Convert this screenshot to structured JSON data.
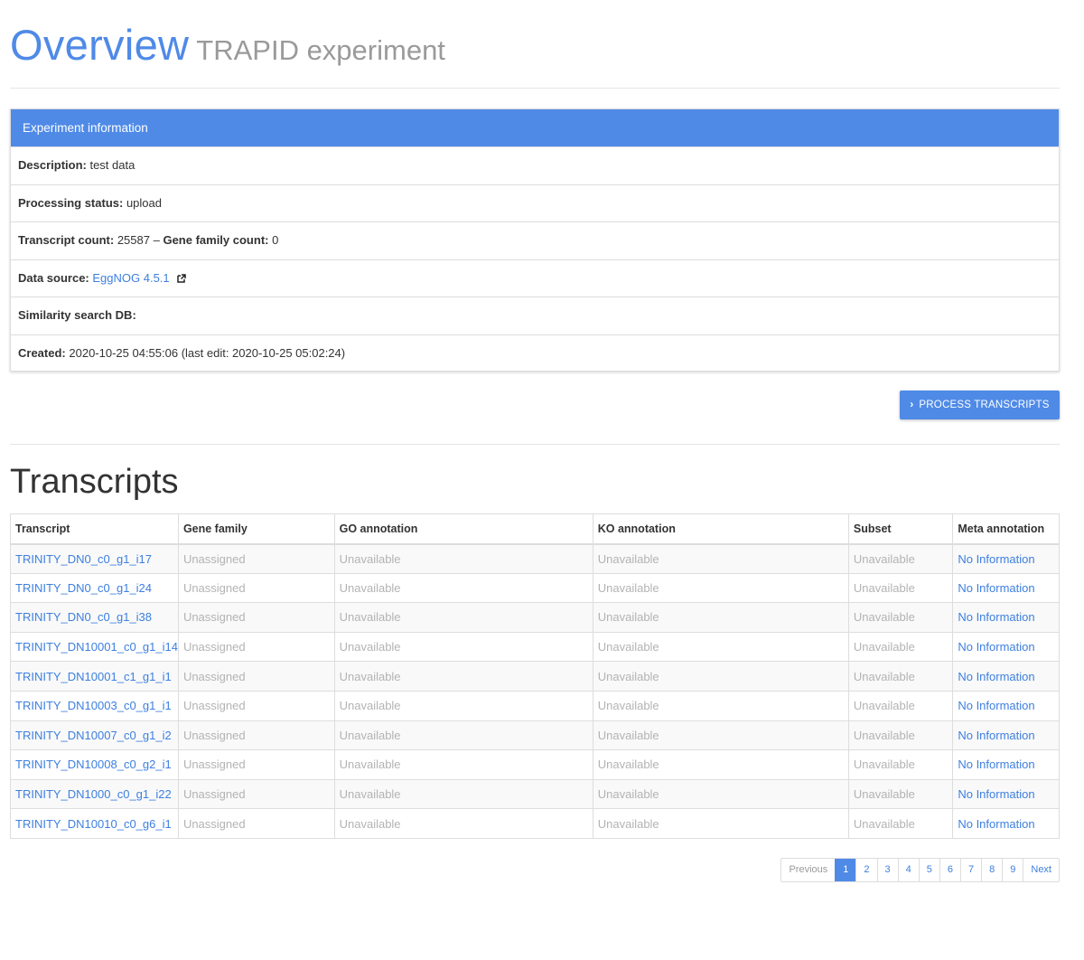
{
  "header": {
    "title": "Overview",
    "subtitle": "TRAPID experiment"
  },
  "experiment_panel": {
    "heading": "Experiment information",
    "description_label": "Description:",
    "description_value": "test data",
    "status_label": "Processing status:",
    "status_value": "upload",
    "transcript_count_label": "Transcript count:",
    "transcript_count_value": "25587",
    "separator": "–",
    "gene_family_count_label": "Gene family count:",
    "gene_family_count_value": "0",
    "data_source_label": "Data source:",
    "data_source_value": "EggNOG 4.5.1",
    "similarity_label": "Similarity search DB:",
    "similarity_value": "",
    "created_label": "Created:",
    "created_value": "2020-10-25 04:55:06 (last edit: 2020-10-25 05:02:24)"
  },
  "actions": {
    "process_label": "PROCESS TRANSCRIPTS",
    "process_icon": "chevron-right-icon"
  },
  "transcripts": {
    "title": "Transcripts",
    "columns": [
      "Transcript",
      "Gene family",
      "GO annotation",
      "KO annotation",
      "Subset",
      "Meta annotation"
    ],
    "rows": [
      {
        "transcript": "TRINITY_DN0_c0_g1_i17",
        "gene_family": "Unassigned",
        "go": "Unavailable",
        "ko": "Unavailable",
        "subset": "Unavailable",
        "meta": "No Information"
      },
      {
        "transcript": "TRINITY_DN0_c0_g1_i24",
        "gene_family": "Unassigned",
        "go": "Unavailable",
        "ko": "Unavailable",
        "subset": "Unavailable",
        "meta": "No Information"
      },
      {
        "transcript": "TRINITY_DN0_c0_g1_i38",
        "gene_family": "Unassigned",
        "go": "Unavailable",
        "ko": "Unavailable",
        "subset": "Unavailable",
        "meta": "No Information"
      },
      {
        "transcript": "TRINITY_DN10001_c0_g1_i14",
        "gene_family": "Unassigned",
        "go": "Unavailable",
        "ko": "Unavailable",
        "subset": "Unavailable",
        "meta": "No Information"
      },
      {
        "transcript": "TRINITY_DN10001_c1_g1_i1",
        "gene_family": "Unassigned",
        "go": "Unavailable",
        "ko": "Unavailable",
        "subset": "Unavailable",
        "meta": "No Information"
      },
      {
        "transcript": "TRINITY_DN10003_c0_g1_i1",
        "gene_family": "Unassigned",
        "go": "Unavailable",
        "ko": "Unavailable",
        "subset": "Unavailable",
        "meta": "No Information"
      },
      {
        "transcript": "TRINITY_DN10007_c0_g1_i2",
        "gene_family": "Unassigned",
        "go": "Unavailable",
        "ko": "Unavailable",
        "subset": "Unavailable",
        "meta": "No Information"
      },
      {
        "transcript": "TRINITY_DN10008_c0_g2_i1",
        "gene_family": "Unassigned",
        "go": "Unavailable",
        "ko": "Unavailable",
        "subset": "Unavailable",
        "meta": "No Information"
      },
      {
        "transcript": "TRINITY_DN1000_c0_g1_i22",
        "gene_family": "Unassigned",
        "go": "Unavailable",
        "ko": "Unavailable",
        "subset": "Unavailable",
        "meta": "No Information"
      },
      {
        "transcript": "TRINITY_DN10010_c0_g6_i1",
        "gene_family": "Unassigned",
        "go": "Unavailable",
        "ko": "Unavailable",
        "subset": "Unavailable",
        "meta": "No Information"
      }
    ]
  },
  "pagination": {
    "previous": "Previous",
    "pages": [
      "1",
      "2",
      "3",
      "4",
      "5",
      "6",
      "7",
      "8",
      "9"
    ],
    "active_page": "1",
    "next": "Next"
  },
  "colors": {
    "accent": "#4f8ae7",
    "link": "#3d7fe0",
    "muted_text": "#b3b3b3"
  }
}
